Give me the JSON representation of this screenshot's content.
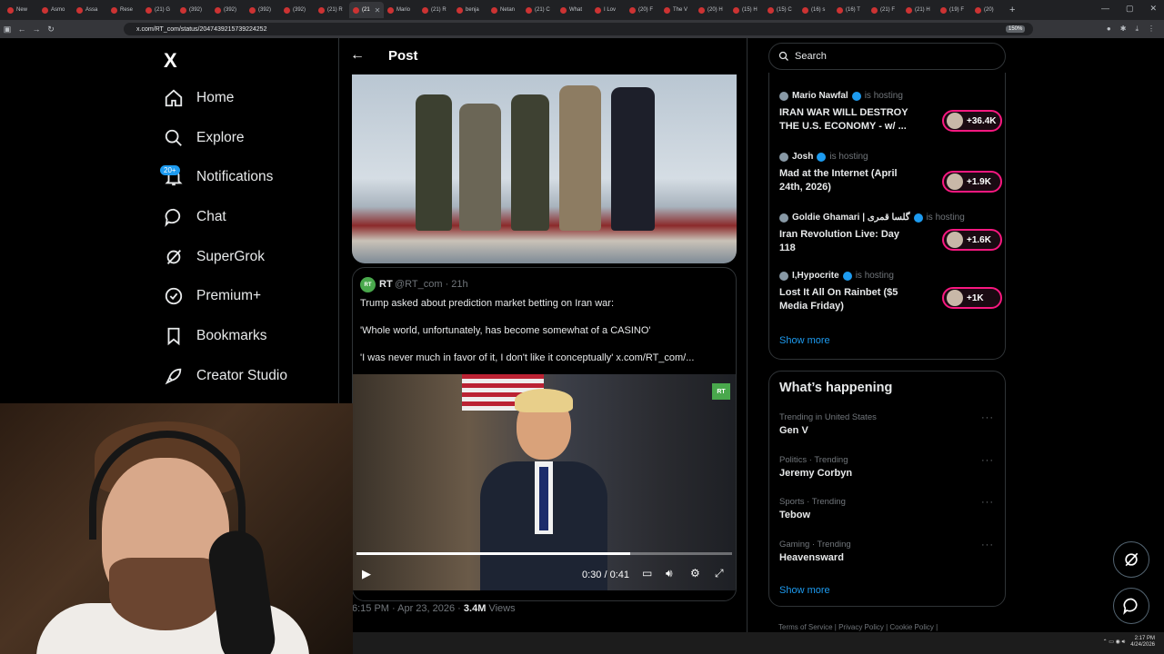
{
  "browser": {
    "tabs": [
      "New",
      "Asmo",
      "Assa",
      "Rese",
      "(21) G",
      "(392)",
      "(392)",
      "(392)",
      "(392)",
      "(21) R",
      "(21",
      "Mario",
      "(21) R",
      "benja",
      "Netan",
      "(21) C",
      "What",
      "I Lov",
      "(20) F",
      "The V",
      "(20) H",
      "(15) H",
      "(15) C",
      "(16) s",
      "(16) T",
      "(21) F",
      "(21) H",
      "(19) F",
      "(20)"
    ],
    "url": "x.com/RT_com/status/2047439215739224252",
    "zoom": "150%"
  },
  "nav": {
    "logo": "X",
    "items": [
      "Home",
      "Explore",
      "Notifications",
      "Chat",
      "SuperGrok",
      "Premium+",
      "Bookmarks",
      "Creator Studio"
    ],
    "notifications_badge": "20+"
  },
  "post": {
    "header_title": "Post",
    "quote": {
      "avatar_text": "RT",
      "name": "RT",
      "handle": "@RT_com · 21h",
      "line1": "Trump asked about prediction market betting on Iran war:",
      "line2": "'Whole world, unfortunately, has become somewhat of a CASINO'",
      "line3": "'I was never much in favor of it, I don't like it conceptually'  x.com/RT_com/...",
      "video_logo": "RT",
      "video_time": "0:30 / 0:41",
      "video_progress": 0.73
    },
    "timestamp": "6:15 PM · Apr 23, 2026 · ",
    "views_count": "3.4M",
    "views_label": " Views"
  },
  "right": {
    "search_placeholder": "Search",
    "spaces": [
      {
        "host": "Mario Nawfal",
        "hosting": "is hosting",
        "title": "IRAN WAR WILL DESTROY THE U.S. ECONOMY - w/ ...",
        "count": "+36.4K"
      },
      {
        "host": "Josh",
        "hosting": "is hosting",
        "title": "Mad at the Internet (April 24th, 2026)",
        "count": "+1.9K"
      },
      {
        "host": "Goldie Ghamari | گلسا قمری",
        "hosting": "is hosting",
        "title": "Iran Revolution Live: Day 118",
        "count": "+1.6K"
      },
      {
        "host": "I,Hypocrite",
        "hosting": "is hosting",
        "title": "Lost It All On Rainbet ($5 Media Friday)",
        "count": "+1K"
      }
    ],
    "spaces_show_more": "Show more",
    "happening_title": "What’s happening",
    "trends": [
      {
        "meta": "Trending in United States",
        "name": "Gen V"
      },
      {
        "meta": "Politics · Trending",
        "name": "Jeremy Corbyn"
      },
      {
        "meta": "Sports · Trending",
        "name": "Tebow"
      },
      {
        "meta": "Gaming · Trending",
        "name": "Heavensward"
      }
    ],
    "trends_show_more": "Show more",
    "footer": "Terms of Service  |  Privacy Policy  |  Cookie Policy  |"
  },
  "taskbar": {
    "time": "2:17 PM",
    "date": "4/24/2026"
  },
  "colors": {
    "accent": "#1d9bf0",
    "live_pink": "#f91880",
    "rt_green": "#49a84c"
  }
}
